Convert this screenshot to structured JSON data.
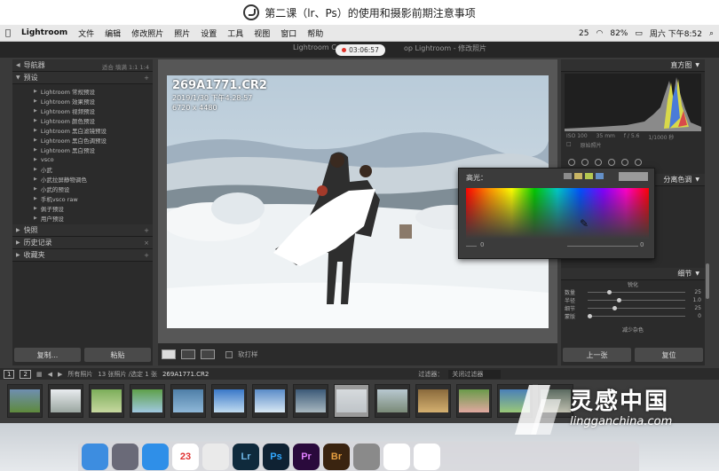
{
  "video_title": "第二课（lr、Ps）的使用和摄影前期注意事项",
  "menubar": {
    "app": "Lightroom",
    "items": [
      "文件",
      "编辑",
      "修改照片",
      "照片",
      "设置",
      "工具",
      "视图",
      "窗口",
      "帮助"
    ],
    "status": {
      "badge": "25",
      "battery": "82%",
      "clock": "周六 下午8:52"
    }
  },
  "lr": {
    "window_title": "Lightroom Catalog.lrca",
    "window_title_right": "op Lightroom - 修改照片",
    "record_time": "03:06:57",
    "left": {
      "navigator": "导航器",
      "nav_options": [
        "适合",
        "填满",
        "1:1",
        "1:4"
      ],
      "presets_header": "预设",
      "presets": [
        "Lightroom 常规预设",
        "Lightroom 效果预设",
        "Lightroom 视频预设",
        "Lightroom 颜色预设",
        "Lightroom 黑白滤镜预设",
        "Lightroom 黑白色调预设",
        "Lightroom 黑白预设",
        "vsco",
        "小武",
        "小武拉屏静物调色",
        "小武的预设",
        "手机vsco raw",
        "佩子预设",
        "用户预设"
      ],
      "snapshots": "快照",
      "history": "历史记录",
      "collections": "收藏夹",
      "copy_btn": "复制...",
      "paste_btn": "粘贴"
    },
    "photo": {
      "filename": "269A1771.CR2",
      "date": "2019/1/30 下午4:28:57",
      "dims": "6720 x 4480"
    },
    "toolbar": {
      "proof_label": "软打样"
    },
    "right": {
      "histogram": "直方图",
      "hist_info": [
        "ISO 100",
        "35 mm",
        "f / 5.6",
        "1/1000 秒"
      ],
      "orig_photo": "原始照片",
      "hsl_header": "分离色调",
      "detail_header": "细节",
      "sharpen_label": "锐化",
      "sliders": [
        {
          "name": "数量",
          "value": "25",
          "pos": 0.2
        },
        {
          "name": "半径",
          "value": "1.0",
          "pos": 0.3
        },
        {
          "name": "细节",
          "value": "25",
          "pos": 0.25
        },
        {
          "name": "蒙版",
          "value": "0",
          "pos": 0.0
        }
      ],
      "noise": "减少杂色",
      "prev_btn": "上一张",
      "reset_btn": "复位"
    },
    "picker": {
      "label": "高光：",
      "swatches": [
        "#8c8c8c",
        "#c8b464",
        "#b4c850",
        "#6490c8"
      ],
      "hue_val": "0",
      "sat_val": "0"
    },
    "filmbar": {
      "pages": [
        "1",
        "2"
      ],
      "source": "所有照片",
      "count": "13 张照片 /选定 1 张",
      "current": "269A1771.CR2",
      "filter_label": "过滤器：",
      "filter_value": "关闭过滤器"
    },
    "thumbs": [
      {
        "c1": "#6f8fb0",
        "c2": "#5e8a3c"
      },
      {
        "c1": "#e8ecef",
        "c2": "#9aa6a0"
      },
      {
        "c1": "#7cae5a",
        "c2": "#c7d8a0"
      },
      {
        "c1": "#5ea04a",
        "c2": "#a0c8e0"
      },
      {
        "c1": "#4f7fa8",
        "c2": "#8fb8d8"
      },
      {
        "c1": "#3a78c8",
        "c2": "#c0dcf0"
      },
      {
        "c1": "#5a8cc8",
        "c2": "#d8e8f4"
      },
      {
        "c1": "#3c5a78",
        "c2": "#a8b8c0"
      },
      {
        "c1": "#d6dadd",
        "c2": "#bfc4c8"
      },
      {
        "c1": "#b8c8d0",
        "c2": "#7a8a78"
      },
      {
        "c1": "#8a6a3c",
        "c2": "#d4b070"
      },
      {
        "c1": "#6a9a4a",
        "c2": "#e0a8a0"
      },
      {
        "c1": "#4a80b8",
        "c2": "#9ac878"
      },
      {
        "c1": "#5a6a60",
        "c2": "#c0c0b0"
      }
    ]
  },
  "watermark": {
    "title": "灵感中国",
    "url": "lingganchina.com"
  },
  "dock": [
    {
      "name": "finder-icon",
      "bg": "#3d8de0",
      "t": ""
    },
    {
      "name": "launchpad-icon",
      "bg": "#6a6a78",
      "t": ""
    },
    {
      "name": "safari-icon",
      "bg": "#2f8fe8",
      "t": ""
    },
    {
      "name": "calendar-icon",
      "bg": "#ffffff",
      "t": "23",
      "fg": "#e03030"
    },
    {
      "name": "qq-icon",
      "bg": "#eaeaea",
      "t": ""
    },
    {
      "name": "lightroom-icon",
      "bg": "#0f2a3c",
      "t": "Lr",
      "fg": "#6fb8e8"
    },
    {
      "name": "photoshop-icon",
      "bg": "#0f2233",
      "t": "Ps",
      "fg": "#31a8ff"
    },
    {
      "name": "premiere-icon",
      "bg": "#2a0a3c",
      "t": "Pr",
      "fg": "#e080ff"
    },
    {
      "name": "bridge-icon",
      "bg": "#3a2410",
      "t": "Br",
      "fg": "#e8a040"
    },
    {
      "name": "settings-icon",
      "bg": "#8a8a8a",
      "t": ""
    },
    {
      "name": "weibo-icon",
      "bg": "#ffffff",
      "t": ""
    },
    {
      "name": "browser-icon",
      "bg": "#ffffff",
      "t": ""
    }
  ]
}
